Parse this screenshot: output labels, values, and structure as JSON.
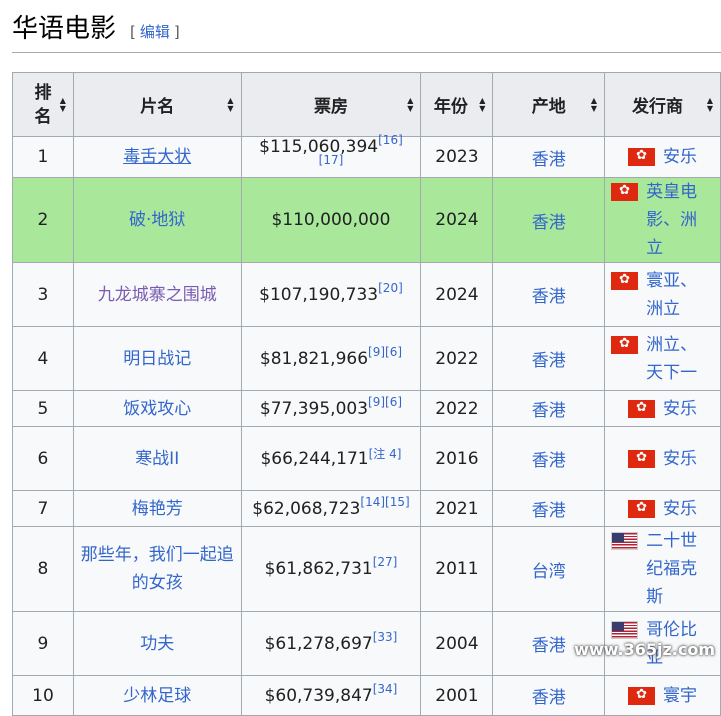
{
  "heading": {
    "title": "华语电影",
    "edit_label": "编辑"
  },
  "columns": [
    "排名",
    "片名",
    "票房",
    "年份",
    "产地",
    "发行商"
  ],
  "rows": [
    {
      "rank": "1",
      "title": "毒舌大状",
      "gross": "$115,060,394",
      "refs": "[16][17]",
      "year": "2023",
      "origin": "香港",
      "distributor": "安乐",
      "flag": "hk"
    },
    {
      "rank": "2",
      "title": "破·地狱",
      "gross": "$110,000,000",
      "refs": "",
      "year": "2024",
      "origin": "香港",
      "distributor": "英皇电影、洲立",
      "flag": "hk"
    },
    {
      "rank": "3",
      "title": "九龙城寨之围城",
      "gross": "$107,190,733",
      "refs": "[20]",
      "year": "2024",
      "origin": "香港",
      "distributor": "寰亚、洲立",
      "flag": "hk"
    },
    {
      "rank": "4",
      "title": "明日战记",
      "gross": "$81,821,966",
      "refs": "[9][6]",
      "year": "2022",
      "origin": "香港",
      "distributor": "洲立、天下一",
      "flag": "hk"
    },
    {
      "rank": "5",
      "title": "饭戏攻心",
      "gross": "$77,395,003",
      "refs": "[9][6]",
      "year": "2022",
      "origin": "香港",
      "distributor": "安乐",
      "flag": "hk"
    },
    {
      "rank": "6",
      "title": "寒战II",
      "gross": "$66,244,171",
      "refs": "[注 4]",
      "year": "2016",
      "origin": "香港",
      "distributor": "安乐",
      "flag": "hk"
    },
    {
      "rank": "7",
      "title": "梅艳芳",
      "gross": "$62,068,723",
      "refs": "[14][15]",
      "year": "2021",
      "origin": "香港",
      "distributor": "安乐",
      "flag": "hk"
    },
    {
      "rank": "8",
      "title": "那些年，我们一起追的女孩",
      "gross": "$61,862,731",
      "refs": "[27]",
      "year": "2011",
      "origin": "台湾",
      "distributor": "二十世纪福克斯",
      "flag": "us"
    },
    {
      "rank": "9",
      "title": "功夫",
      "gross": "$61,278,697",
      "refs": "[33]",
      "year": "2004",
      "origin": "香港",
      "distributor": "哥伦比亚",
      "flag": "us"
    },
    {
      "rank": "10",
      "title": "少林足球",
      "gross": "$60,739,847",
      "refs": "[34]",
      "year": "2001",
      "origin": "香港",
      "distributor": "寰宇",
      "flag": "hk"
    }
  ],
  "watermark": "www.365jz.com"
}
